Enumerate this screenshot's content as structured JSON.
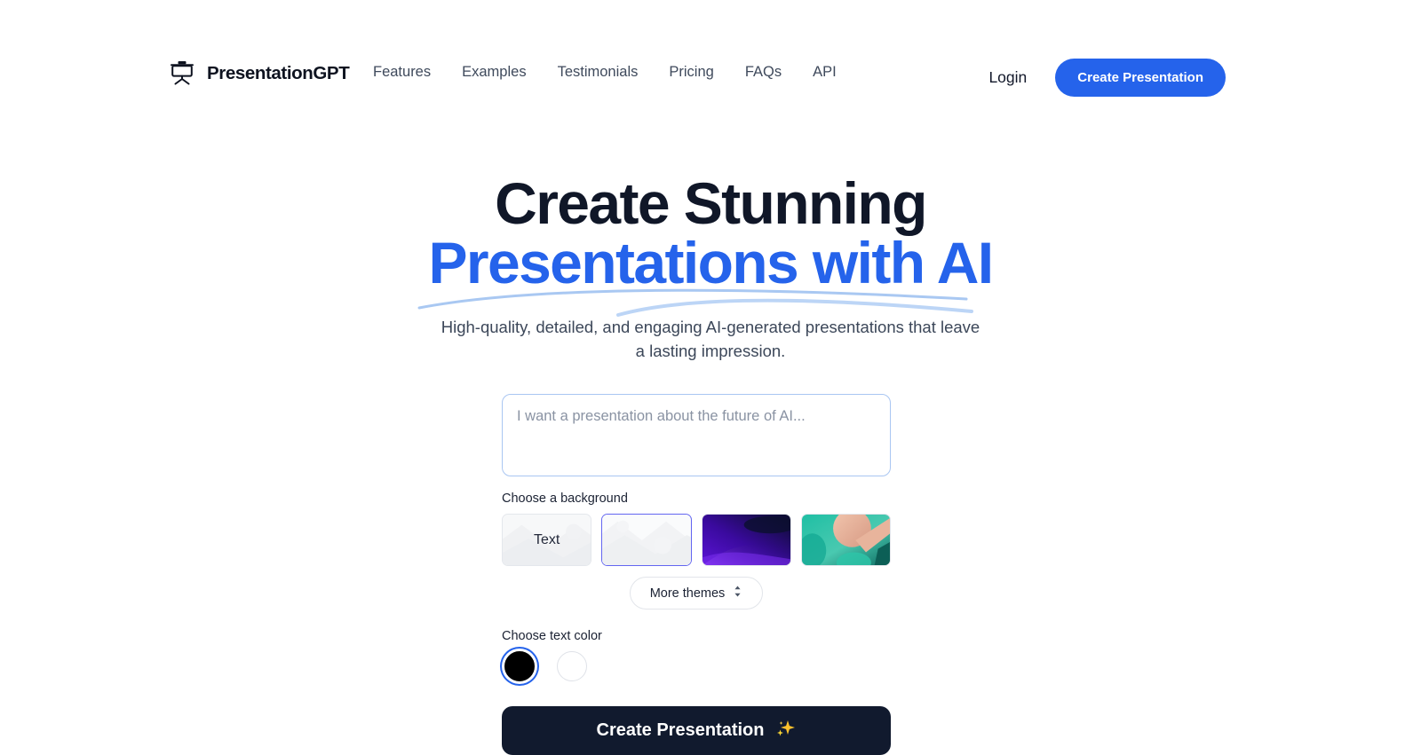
{
  "brand": {
    "name": "PresentationGPT",
    "logo_icon": "presentation-board-icon"
  },
  "nav": {
    "items": [
      {
        "label": "Features"
      },
      {
        "label": "Examples"
      },
      {
        "label": "Testimonials"
      },
      {
        "label": "Pricing"
      },
      {
        "label": "FAQs"
      },
      {
        "label": "API"
      }
    ],
    "login_label": "Login",
    "cta_label": "Create Presentation"
  },
  "hero": {
    "title_line1": "Create Stunning",
    "title_line2": "Presentations with AI",
    "subtitle": "High-quality, detailed, and engaging AI-generated presentations that leave a lasting impression."
  },
  "form": {
    "prompt_placeholder": "I want a presentation about the future of AI...",
    "prompt_value": "",
    "background_label": "Choose a background",
    "themes": [
      {
        "name": "text-theme",
        "label": "Text",
        "selected": false
      },
      {
        "name": "light-pattern-theme",
        "label": "",
        "selected": true
      },
      {
        "name": "purple-gradient-theme",
        "label": "",
        "selected": false
      },
      {
        "name": "teal-peach-theme",
        "label": "",
        "selected": false
      }
    ],
    "more_themes_label": "More themes",
    "more_themes_icon": "chevron-up-down-icon",
    "text_color_label": "Choose text color",
    "colors": [
      {
        "name": "black",
        "hex": "#000000",
        "selected": true
      },
      {
        "name": "white",
        "hex": "#ffffff",
        "selected": false
      }
    ],
    "submit_label": "Create Presentation",
    "submit_icon": "sparkles-icon"
  },
  "colors": {
    "accent_blue": "#2563eb",
    "selected_border": "#6366f1",
    "cta_dark": "#111a2e",
    "swoosh_blue": "#a9c8f2",
    "heading_dark": "#101728"
  }
}
